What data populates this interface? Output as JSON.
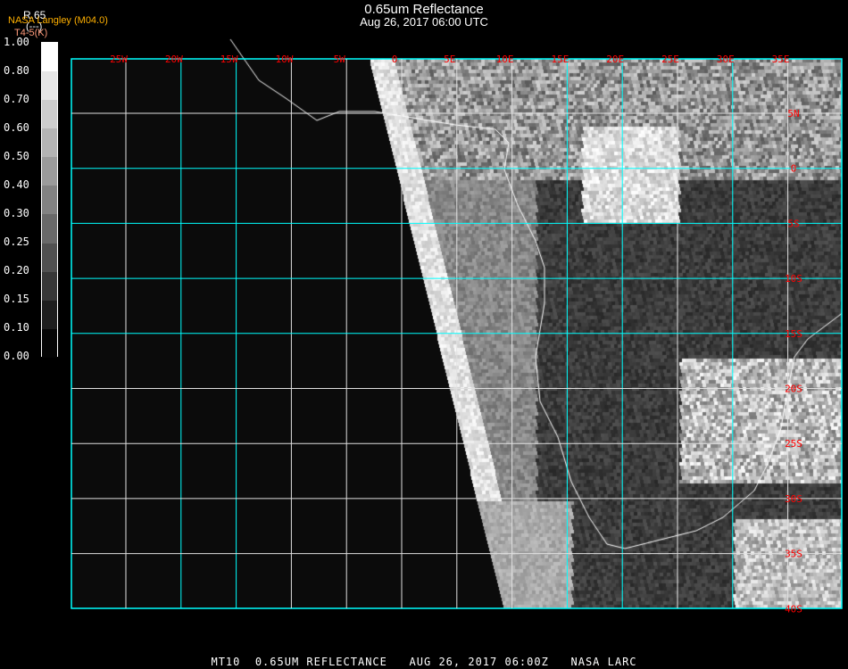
{
  "header": {
    "title": "0.65um Reflectance",
    "subtitle": "Aug 26, 2017 06:00 UTC",
    "product_code": "R.65",
    "product_units": "(---)",
    "producer": "NASA Langley (M04.0)",
    "secondary": "T4-5(K)"
  },
  "colorbar": {
    "labels": [
      "1.00",
      "0.80",
      "0.70",
      "0.60",
      "0.50",
      "0.40",
      "0.30",
      "0.25",
      "0.20",
      "0.15",
      "0.10",
      "0.00"
    ]
  },
  "map": {
    "lon_labels": [
      "25W",
      "20W",
      "15W",
      "10W",
      "5W",
      "0",
      "5E",
      "10E",
      "15E",
      "20E",
      "25E",
      "30E",
      "35E"
    ],
    "lat_labels": [
      "5N",
      "0",
      "5S",
      "10S",
      "15S",
      "20S",
      "25S",
      "30S",
      "35S",
      "40S"
    ],
    "grid_colors": {
      "cyan": "#00ffff",
      "white": "#e0e0e0"
    },
    "label_color": "#ff0000"
  },
  "footer": "MT10  0.65UM REFLECTANCE   AUG 26, 2017 06:00Z   NASA LARC",
  "colors": {
    "producer": "#ffb000",
    "secondary": "#ff9a7a"
  }
}
